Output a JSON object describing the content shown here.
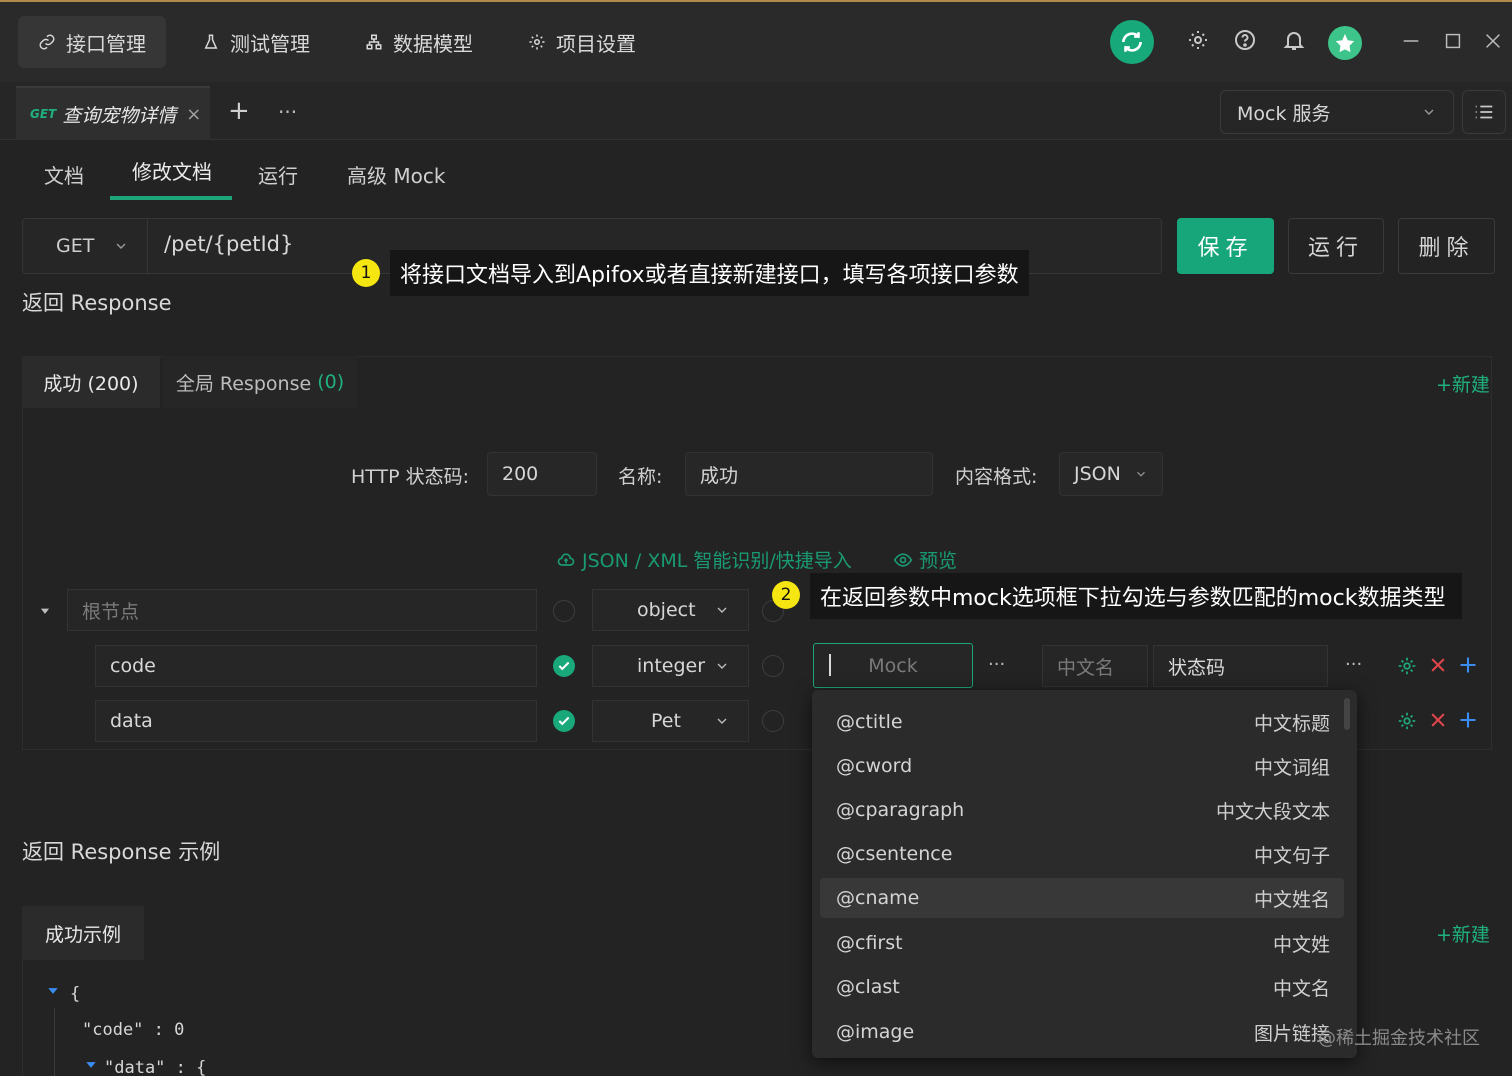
{
  "topnav": {
    "items": [
      {
        "label": "接口管理",
        "active": true
      },
      {
        "label": "测试管理",
        "active": false
      },
      {
        "label": "数据模型",
        "active": false
      },
      {
        "label": "项目设置",
        "active": false
      }
    ]
  },
  "doc_tab": {
    "method": "GET",
    "title": "查询宠物详情",
    "close": "×"
  },
  "tabbar": {
    "add": "+",
    "more": "···"
  },
  "mock_service": {
    "label": "Mock 服务"
  },
  "subtabs": [
    {
      "label": "文档"
    },
    {
      "label": "修改文档",
      "active": true
    },
    {
      "label": "运行"
    },
    {
      "label": "高级 Mock"
    }
  ],
  "request": {
    "method": "GET",
    "path": "/pet/{petId}"
  },
  "actions": {
    "save": "保存",
    "run": "运行",
    "delete": "删除"
  },
  "callout1": {
    "number": "1",
    "text": "将接口文档导入到Apifox或者直接新建接口，填写各项接口参数"
  },
  "callout2": {
    "number": "2",
    "text": "在返回参数中mock选项框下拉勾选与参数匹配的mock数据类型"
  },
  "response": {
    "heading": "返回 Response",
    "tabs": [
      {
        "label": "成功 (200)",
        "active": true
      },
      {
        "label": "全局 Response",
        "count": "(0)"
      }
    ],
    "new": "+新建",
    "status_label": "HTTP 状态码:",
    "status": "200",
    "name_label": "名称:",
    "name": "成功",
    "format_label": "内容格式:",
    "format": "JSON",
    "import_link": "JSON / XML 智能识别/快捷导入",
    "preview_link": "预览"
  },
  "schema": {
    "root": {
      "placeholder": "根节点",
      "type": "object"
    },
    "rows": [
      {
        "name": "code",
        "type": "integer",
        "checked": true,
        "mock_placeholder": "Mock",
        "cn_placeholder": "中文名",
        "desc": "状态码"
      },
      {
        "name": "data",
        "type": "Pet",
        "checked": true
      }
    ],
    "more": "···"
  },
  "mock_options": [
    {
      "value": "@ctitle",
      "desc": "中文标题"
    },
    {
      "value": "@cword",
      "desc": "中文词组"
    },
    {
      "value": "@cparagraph",
      "desc": "中文大段文本"
    },
    {
      "value": "@csentence",
      "desc": "中文句子"
    },
    {
      "value": "@cname",
      "desc": "中文姓名",
      "highlighted": true
    },
    {
      "value": "@cfirst",
      "desc": "中文姓"
    },
    {
      "value": "@clast",
      "desc": "中文名"
    },
    {
      "value": "@image",
      "desc": "图片链接"
    }
  ],
  "example": {
    "heading": "返回 Response 示例",
    "tab": "成功示例",
    "new": "+新建",
    "lines": [
      "{",
      "\"code\" : 0",
      "\"data\" : {"
    ]
  },
  "watermark": "@稀土掘金技术社区",
  "colors": {
    "accent": "#16a67a",
    "background": "#232323",
    "callout_badge": "#f5e510",
    "delete": "#e0454a",
    "add": "#3b8cf0"
  }
}
